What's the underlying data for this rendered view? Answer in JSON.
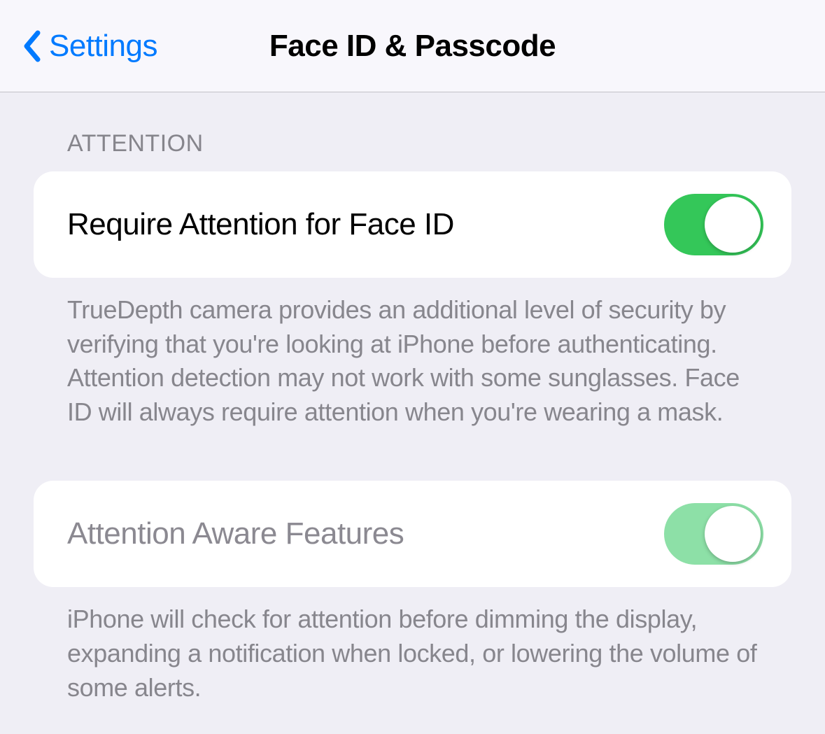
{
  "header": {
    "back_label": "Settings",
    "title": "Face ID & Passcode"
  },
  "attention": {
    "section_header": "ATTENTION",
    "require_attention": {
      "label": "Require Attention for Face ID",
      "on": true,
      "footer": "TrueDepth camera provides an additional level of security by verifying that you're looking at iPhone before authenticating. Attention detection may not work with some sunglasses. Face ID will always require attention when you're wearing a mask."
    },
    "attention_aware": {
      "label": "Attention Aware Features",
      "on": true,
      "footer": "iPhone will check for attention before dimming the display, expanding a notification when locked, or lowering the volume of some alerts."
    }
  }
}
